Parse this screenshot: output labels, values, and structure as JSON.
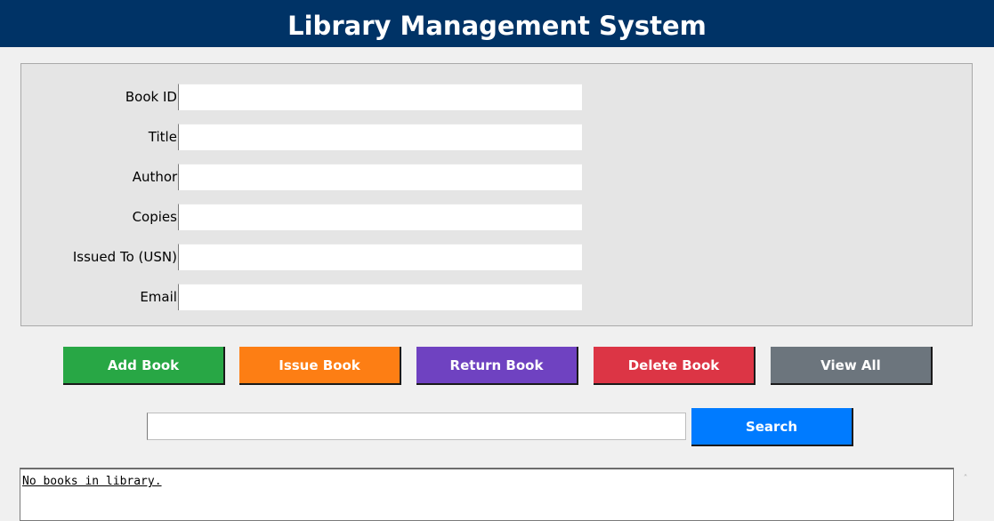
{
  "app": {
    "title": "Library Management System"
  },
  "form": {
    "fields": [
      {
        "label": "Book ID:",
        "value": ""
      },
      {
        "label": "Title:",
        "value": ""
      },
      {
        "label": "Author:",
        "value": ""
      },
      {
        "label": "Copies:",
        "value": ""
      },
      {
        "label": "Issued To (USN):",
        "value": ""
      },
      {
        "label": "Email:",
        "value": ""
      }
    ]
  },
  "actions": {
    "add_book": "Add Book",
    "issue_book": "Issue Book",
    "return_book": "Return Book",
    "delete_book": "Delete Book",
    "view_all": "View All"
  },
  "search": {
    "value": "",
    "button_label": "Search"
  },
  "output": {
    "text": "No books in library."
  },
  "colors": {
    "header_bg": "#003366",
    "add": "#28a745",
    "issue": "#fd7e14",
    "return": "#6f42c1",
    "delete": "#dc3545",
    "view_all": "#6c757d",
    "search": "#007bff"
  },
  "icons": {
    "scroll_up": "chevron-up-icon"
  }
}
